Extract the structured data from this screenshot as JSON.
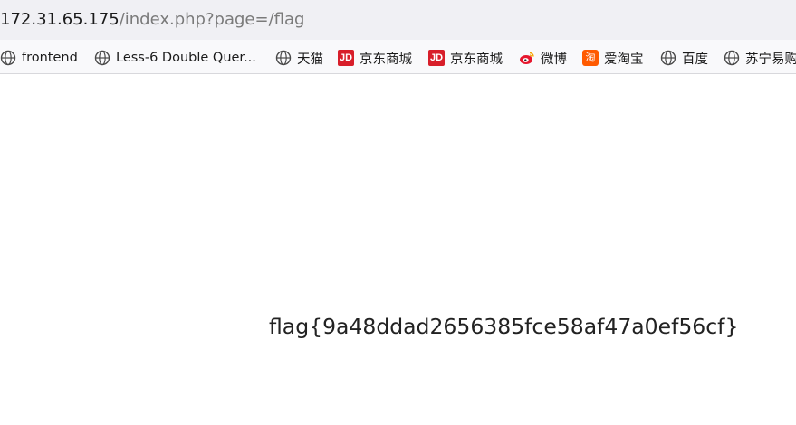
{
  "address_bar": {
    "host": "172.31.65.175",
    "path": "/index.php?page=/flag"
  },
  "bookmarks": [
    {
      "label": "frontend",
      "icon": "globe-icon"
    },
    {
      "label": "Less-6 Double Quer...",
      "icon": "globe-icon"
    },
    {
      "label": "天猫",
      "icon": "globe-icon"
    },
    {
      "label": "京东商城",
      "icon": "jd-logo-icon",
      "icon_text": "JD",
      "icon_color": "#d81e2a"
    },
    {
      "label": "京东商城",
      "icon": "jd-logo-icon",
      "icon_text": "JD",
      "icon_color": "#d81e2a"
    },
    {
      "label": "微博",
      "icon": "weibo-icon"
    },
    {
      "label": "爱淘宝",
      "icon": "taobao-icon",
      "icon_text": "淘",
      "icon_color": "#ff5a00"
    },
    {
      "label": "百度",
      "icon": "globe-icon"
    },
    {
      "label": "苏宁易购",
      "icon": "globe-icon"
    }
  ],
  "content": {
    "flag": "flag{9a48ddad2656385fce58af47a0ef56cf}"
  }
}
